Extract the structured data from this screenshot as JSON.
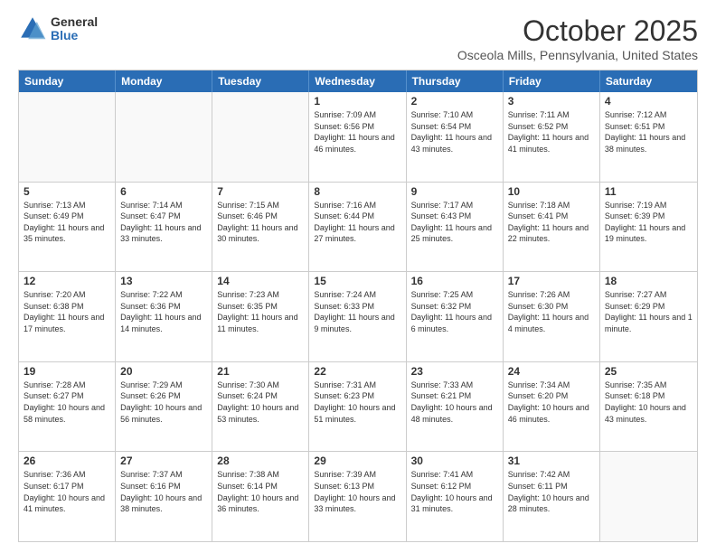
{
  "logo": {
    "general": "General",
    "blue": "Blue"
  },
  "header": {
    "month": "October 2025",
    "location": "Osceola Mills, Pennsylvania, United States"
  },
  "days": [
    "Sunday",
    "Monday",
    "Tuesday",
    "Wednesday",
    "Thursday",
    "Friday",
    "Saturday"
  ],
  "rows": [
    [
      {
        "day": "",
        "text": ""
      },
      {
        "day": "",
        "text": ""
      },
      {
        "day": "",
        "text": ""
      },
      {
        "day": "1",
        "text": "Sunrise: 7:09 AM\nSunset: 6:56 PM\nDaylight: 11 hours and 46 minutes."
      },
      {
        "day": "2",
        "text": "Sunrise: 7:10 AM\nSunset: 6:54 PM\nDaylight: 11 hours and 43 minutes."
      },
      {
        "day": "3",
        "text": "Sunrise: 7:11 AM\nSunset: 6:52 PM\nDaylight: 11 hours and 41 minutes."
      },
      {
        "day": "4",
        "text": "Sunrise: 7:12 AM\nSunset: 6:51 PM\nDaylight: 11 hours and 38 minutes."
      }
    ],
    [
      {
        "day": "5",
        "text": "Sunrise: 7:13 AM\nSunset: 6:49 PM\nDaylight: 11 hours and 35 minutes."
      },
      {
        "day": "6",
        "text": "Sunrise: 7:14 AM\nSunset: 6:47 PM\nDaylight: 11 hours and 33 minutes."
      },
      {
        "day": "7",
        "text": "Sunrise: 7:15 AM\nSunset: 6:46 PM\nDaylight: 11 hours and 30 minutes."
      },
      {
        "day": "8",
        "text": "Sunrise: 7:16 AM\nSunset: 6:44 PM\nDaylight: 11 hours and 27 minutes."
      },
      {
        "day": "9",
        "text": "Sunrise: 7:17 AM\nSunset: 6:43 PM\nDaylight: 11 hours and 25 minutes."
      },
      {
        "day": "10",
        "text": "Sunrise: 7:18 AM\nSunset: 6:41 PM\nDaylight: 11 hours and 22 minutes."
      },
      {
        "day": "11",
        "text": "Sunrise: 7:19 AM\nSunset: 6:39 PM\nDaylight: 11 hours and 19 minutes."
      }
    ],
    [
      {
        "day": "12",
        "text": "Sunrise: 7:20 AM\nSunset: 6:38 PM\nDaylight: 11 hours and 17 minutes."
      },
      {
        "day": "13",
        "text": "Sunrise: 7:22 AM\nSunset: 6:36 PM\nDaylight: 11 hours and 14 minutes."
      },
      {
        "day": "14",
        "text": "Sunrise: 7:23 AM\nSunset: 6:35 PM\nDaylight: 11 hours and 11 minutes."
      },
      {
        "day": "15",
        "text": "Sunrise: 7:24 AM\nSunset: 6:33 PM\nDaylight: 11 hours and 9 minutes."
      },
      {
        "day": "16",
        "text": "Sunrise: 7:25 AM\nSunset: 6:32 PM\nDaylight: 11 hours and 6 minutes."
      },
      {
        "day": "17",
        "text": "Sunrise: 7:26 AM\nSunset: 6:30 PM\nDaylight: 11 hours and 4 minutes."
      },
      {
        "day": "18",
        "text": "Sunrise: 7:27 AM\nSunset: 6:29 PM\nDaylight: 11 hours and 1 minute."
      }
    ],
    [
      {
        "day": "19",
        "text": "Sunrise: 7:28 AM\nSunset: 6:27 PM\nDaylight: 10 hours and 58 minutes."
      },
      {
        "day": "20",
        "text": "Sunrise: 7:29 AM\nSunset: 6:26 PM\nDaylight: 10 hours and 56 minutes."
      },
      {
        "day": "21",
        "text": "Sunrise: 7:30 AM\nSunset: 6:24 PM\nDaylight: 10 hours and 53 minutes."
      },
      {
        "day": "22",
        "text": "Sunrise: 7:31 AM\nSunset: 6:23 PM\nDaylight: 10 hours and 51 minutes."
      },
      {
        "day": "23",
        "text": "Sunrise: 7:33 AM\nSunset: 6:21 PM\nDaylight: 10 hours and 48 minutes."
      },
      {
        "day": "24",
        "text": "Sunrise: 7:34 AM\nSunset: 6:20 PM\nDaylight: 10 hours and 46 minutes."
      },
      {
        "day": "25",
        "text": "Sunrise: 7:35 AM\nSunset: 6:18 PM\nDaylight: 10 hours and 43 minutes."
      }
    ],
    [
      {
        "day": "26",
        "text": "Sunrise: 7:36 AM\nSunset: 6:17 PM\nDaylight: 10 hours and 41 minutes."
      },
      {
        "day": "27",
        "text": "Sunrise: 7:37 AM\nSunset: 6:16 PM\nDaylight: 10 hours and 38 minutes."
      },
      {
        "day": "28",
        "text": "Sunrise: 7:38 AM\nSunset: 6:14 PM\nDaylight: 10 hours and 36 minutes."
      },
      {
        "day": "29",
        "text": "Sunrise: 7:39 AM\nSunset: 6:13 PM\nDaylight: 10 hours and 33 minutes."
      },
      {
        "day": "30",
        "text": "Sunrise: 7:41 AM\nSunset: 6:12 PM\nDaylight: 10 hours and 31 minutes."
      },
      {
        "day": "31",
        "text": "Sunrise: 7:42 AM\nSunset: 6:11 PM\nDaylight: 10 hours and 28 minutes."
      },
      {
        "day": "",
        "text": ""
      }
    ]
  ]
}
